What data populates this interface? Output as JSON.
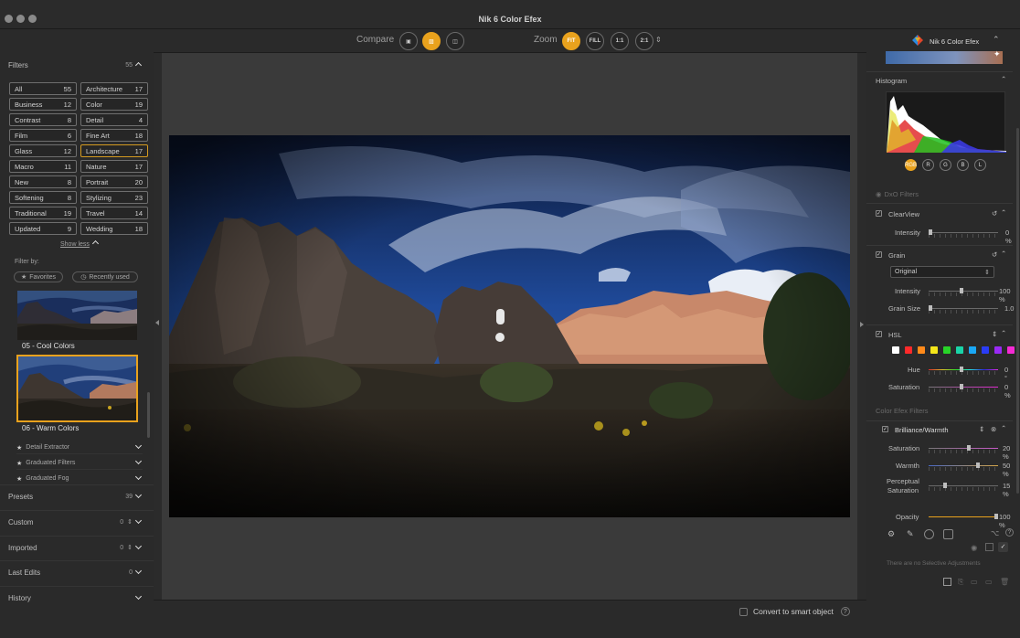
{
  "window": {
    "title": "Nik 6 Color Efex"
  },
  "left_panel": {
    "filters_header": {
      "label": "Filters",
      "count": "55"
    },
    "categories": [
      {
        "label": "All",
        "count": "55"
      },
      {
        "label": "Architecture",
        "count": "17"
      },
      {
        "label": "Business",
        "count": "12"
      },
      {
        "label": "Color",
        "count": "19"
      },
      {
        "label": "Contrast",
        "count": "8"
      },
      {
        "label": "Detail",
        "count": "4"
      },
      {
        "label": "Film",
        "count": "6"
      },
      {
        "label": "Fine Art",
        "count": "18"
      },
      {
        "label": "Glass",
        "count": "12"
      },
      {
        "label": "Landscape",
        "count": "17"
      },
      {
        "label": "Macro",
        "count": "11"
      },
      {
        "label": "Nature",
        "count": "17"
      },
      {
        "label": "New",
        "count": "8"
      },
      {
        "label": "Portrait",
        "count": "20"
      },
      {
        "label": "Softening",
        "count": "8"
      },
      {
        "label": "Stylizing",
        "count": "23"
      },
      {
        "label": "Traditional",
        "count": "19"
      },
      {
        "label": "Travel",
        "count": "14"
      },
      {
        "label": "Updated",
        "count": "9"
      },
      {
        "label": "Wedding",
        "count": "18"
      }
    ],
    "active_category": "Landscape",
    "show_less": "Show less",
    "filter_by": "Filter by:",
    "favorites": "Favorites",
    "recently_used": "Recently used",
    "presets_thumbs": [
      {
        "label": "05 - Cool Colors"
      },
      {
        "label": "06 - Warm Colors"
      }
    ],
    "filter_list": [
      "Detail Extractor",
      "Graduated Filters",
      "Graduated Fog"
    ],
    "sections": [
      {
        "label": "Presets",
        "count": "39"
      },
      {
        "label": "Custom",
        "count": "0"
      },
      {
        "label": "Imported",
        "count": "0"
      },
      {
        "label": "Last Edits",
        "count": "0"
      },
      {
        "label": "History",
        "count": ""
      }
    ]
  },
  "toolbar": {
    "compare_label": "Compare",
    "zoom_label": "Zoom",
    "zoom_buttons": [
      "FIT",
      "FILL",
      "1:1",
      "2:1"
    ],
    "active_zoom": "FIT"
  },
  "bottom_bar": {
    "convert_label": "Convert to smart object",
    "help": "?"
  },
  "right_panel": {
    "app_name": "Nik 6 Color Efex",
    "histogram": {
      "label": "Histogram",
      "channels": [
        "RGB",
        "R",
        "G",
        "B",
        "L"
      ],
      "active_channel": "RGB"
    },
    "dxo_filters_label": "DxO Filters",
    "clearview": {
      "label": "ClearView",
      "intensity_label": "Intensity",
      "intensity_value": "0 %",
      "intensity": 0
    },
    "grain": {
      "label": "Grain",
      "mode": "Original",
      "intensity_label": "Intensity",
      "intensity_value": "100 %",
      "intensity": 100,
      "size_label": "Grain Size",
      "size_value": "1.0"
    },
    "hsl": {
      "label": "HSL",
      "swatches": [
        "#ffffff",
        "#ff2a2a",
        "#ff8a1a",
        "#f5e61a",
        "#28d428",
        "#1ad4a8",
        "#1aa8f5",
        "#2a3cf5",
        "#9a2af5",
        "#f52ad4"
      ],
      "hue_label": "Hue",
      "hue_value": "0 °",
      "saturation_label": "Saturation",
      "saturation_value": "0 %"
    },
    "color_efex_label": "Color Efex Filters",
    "brilliance": {
      "label": "Brilliance/Warmth",
      "saturation_label": "Saturation",
      "saturation_value": "20 %",
      "saturation": 20,
      "warmth_label": "Warmth",
      "warmth_value": "50 %",
      "warmth": 50,
      "perceptual_label_1": "Perceptual",
      "perceptual_label_2": "Saturation",
      "perceptual_value": "15 %",
      "perceptual": 15,
      "opacity_label": "Opacity",
      "opacity_value": "100 %",
      "opacity": 100
    },
    "no_selective": "There are no Selective Adjustments"
  }
}
